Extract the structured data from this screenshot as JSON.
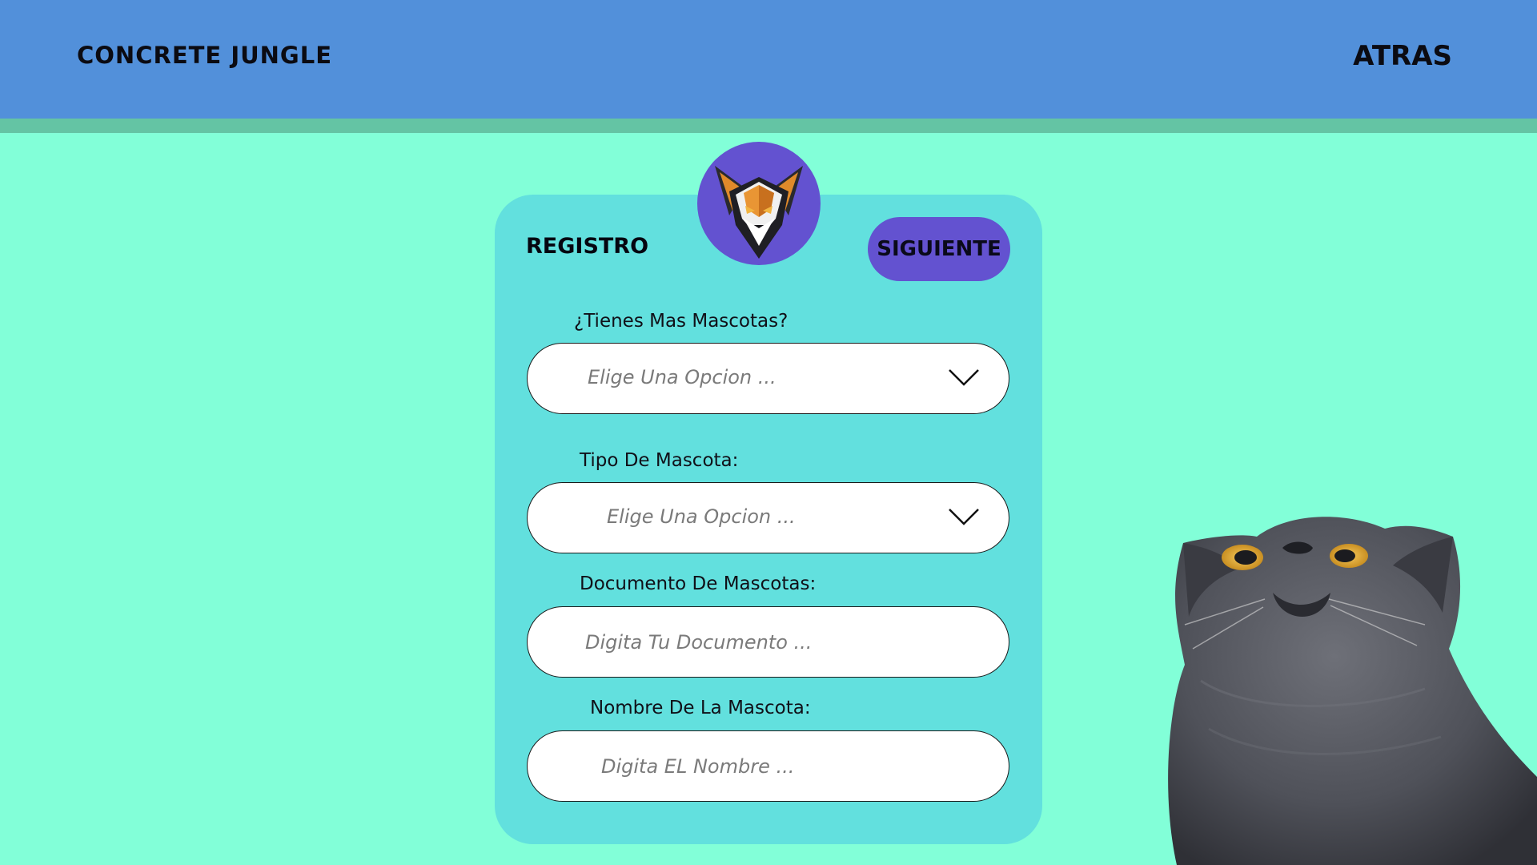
{
  "header": {
    "brand": "CONCRETE JUNGLE",
    "back_label": "ATRAS"
  },
  "card": {
    "title": "REGISTRO",
    "next_label": "SIGUIENTE",
    "logo_icon": "fox-logo-icon"
  },
  "form": {
    "more_pets": {
      "label": "¿Tienes Mas Mascotas?",
      "placeholder": "Elige Una Opcion ..."
    },
    "pet_type": {
      "label": "Tipo De Mascota:",
      "placeholder": "Elige Una Opcion ..."
    },
    "pet_document": {
      "label": "Documento De Mascotas:",
      "placeholder": "Digita Tu Documento ..."
    },
    "pet_name": {
      "label": "Nombre De La Mascota:",
      "placeholder": "Digita EL Nombre ..."
    }
  },
  "decor": {
    "image": "gray-cat-photo",
    "chevron_icon": "chevron-down-icon"
  },
  "colors": {
    "background": "#82ffd8",
    "header": "#5290da",
    "header_strip": "#64c4a4",
    "card": "#62e0de",
    "accent": "#6352d0"
  }
}
